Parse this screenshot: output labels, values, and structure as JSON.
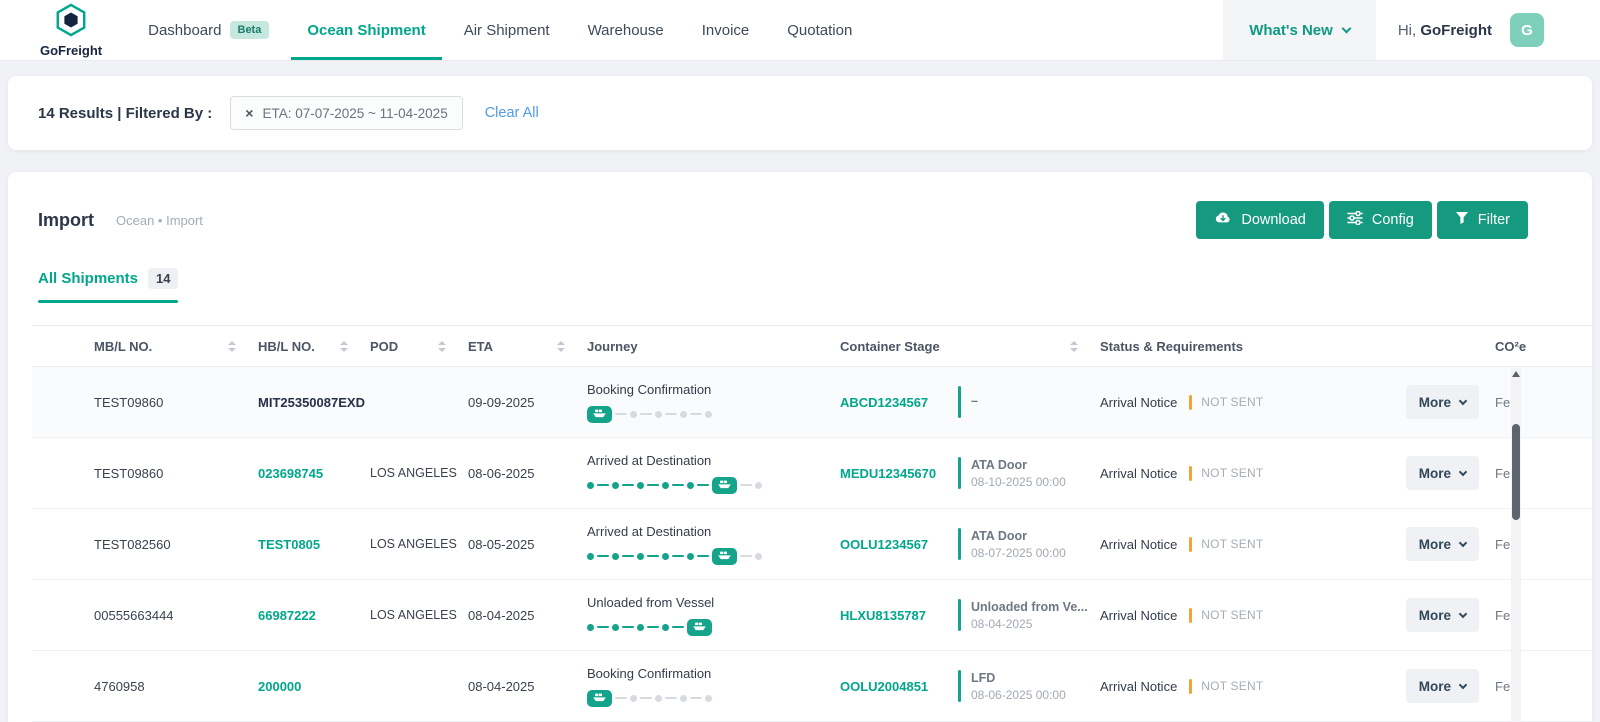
{
  "brand": {
    "name": "GoFreight"
  },
  "nav": {
    "items": [
      {
        "label": "Dashboard",
        "badge": "Beta"
      },
      {
        "label": "Ocean Shipment"
      },
      {
        "label": "Air Shipment"
      },
      {
        "label": "Warehouse"
      },
      {
        "label": "Invoice"
      },
      {
        "label": "Quotation"
      }
    ],
    "whats_new": "What's New",
    "greeting_prefix": "Hi,",
    "greeting_name": "GoFreight",
    "avatar_letter": "G"
  },
  "filter_bar": {
    "results_text": "14 Results | Filtered By :",
    "chip_label": "ETA: 07-07-2025 ~ 11-04-2025",
    "clear_all_label": "Clear All"
  },
  "page": {
    "title": "Import",
    "breadcrumb": "Ocean • Import",
    "download_label": "Download",
    "config_label": "Config",
    "filter_label": "Filter",
    "tab_label": "All Shipments",
    "tab_count": "14"
  },
  "table": {
    "headers": {
      "mbl": "MB/L NO.",
      "hbl": "HB/L NO.",
      "pod": "POD",
      "eta": "ETA",
      "journey": "Journey",
      "container_stage": "Container Stage",
      "status": "Status & Requirements",
      "co2e": "CO²e"
    },
    "more_label": "More",
    "rows": [
      {
        "mbl": "TEST09860",
        "hbl": "MIT25350087EXD",
        "pod": "",
        "eta": "09-09-2025",
        "journey": {
          "label": "Booking Confirmation",
          "nodes": [
            "ship",
            "pending",
            "pending",
            "pending",
            "pending"
          ]
        },
        "container": {
          "no": "ABCD1234567",
          "stage": "–",
          "date": ""
        },
        "status": {
          "label": "Arrival Notice",
          "value": "NOT SENT"
        },
        "co2e": "Fe"
      },
      {
        "mbl": "TEST09860",
        "hbl": "023698745",
        "pod": "LOS ANGELES",
        "eta": "08-06-2025",
        "journey": {
          "label": "Arrived at Destination",
          "nodes": [
            "done",
            "done",
            "done",
            "done",
            "done",
            "ship",
            "pending"
          ]
        },
        "container": {
          "no": "MEDU12345670",
          "stage": "ATA Door",
          "date": "08-10-2025 00:00"
        },
        "status": {
          "label": "Arrival Notice",
          "value": "NOT SENT"
        },
        "co2e": "Fe"
      },
      {
        "mbl": "TEST082560",
        "hbl": "TEST0805",
        "pod": "LOS ANGELES",
        "eta": "08-05-2025",
        "journey": {
          "label": "Arrived at Destination",
          "nodes": [
            "done",
            "done",
            "done",
            "done",
            "done",
            "ship",
            "pending"
          ]
        },
        "container": {
          "no": "OOLU1234567",
          "stage": "ATA Door",
          "date": "08-07-2025 00:00"
        },
        "status": {
          "label": "Arrival Notice",
          "value": "NOT SENT"
        },
        "co2e": "Fe"
      },
      {
        "mbl": "00555663444",
        "hbl": "66987222",
        "pod": "LOS ANGELES",
        "eta": "08-04-2025",
        "journey": {
          "label": "Unloaded from Vessel",
          "nodes": [
            "done",
            "done",
            "done",
            "done",
            "ship"
          ]
        },
        "container": {
          "no": "HLXU8135787",
          "stage": "Unloaded from Ve...",
          "date": "08-04-2025"
        },
        "status": {
          "label": "Arrival Notice",
          "value": "NOT SENT"
        },
        "co2e": "Fe"
      },
      {
        "mbl": "4760958",
        "hbl": "200000",
        "pod": "",
        "eta": "08-04-2025",
        "journey": {
          "label": "Booking Confirmation",
          "nodes": [
            "ship",
            "pending",
            "pending",
            "pending",
            "pending"
          ]
        },
        "container": {
          "no": "OOLU2004851",
          "stage": "LFD",
          "date": "08-06-2025 00:00"
        },
        "status": {
          "label": "Arrival Notice",
          "value": "NOT SENT"
        },
        "co2e": "Fe"
      }
    ]
  },
  "colors": {
    "accent_teal": "#00A78B",
    "journey_teal": "#14A38B",
    "status_orange": "#F2A43C",
    "link_blue": "#4D9BE8"
  }
}
